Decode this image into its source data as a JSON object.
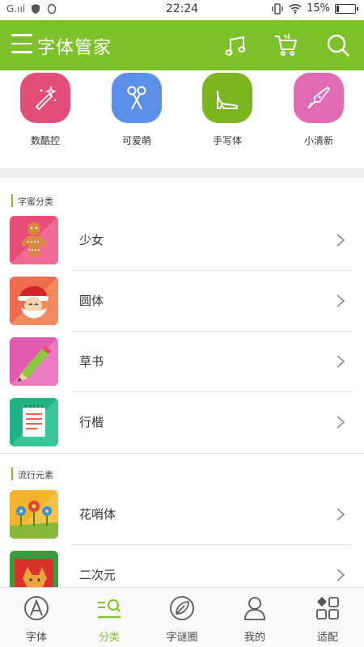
{
  "status_bar": {
    "carrier": "G.ııl",
    "time": "22:24",
    "battery_pct_text": "15%",
    "battery_level": 0.15
  },
  "app_bar": {
    "title": "字体管家",
    "icons": [
      "menu-icon",
      "music-note-icon",
      "cart-icon",
      "search-icon"
    ]
  },
  "featured": [
    {
      "label": "数酷控",
      "color": "#e24e79",
      "icon": "magic-wand-icon"
    },
    {
      "label": "可爱萌",
      "color": "#5a8ee8",
      "icon": "scissors-icon"
    },
    {
      "label": "手写体",
      "color": "#7bb520",
      "icon": "high-heel-icon"
    },
    {
      "label": "小清新",
      "color": "#e06ab4",
      "icon": "fountain-pen-icon"
    }
  ],
  "sections": [
    {
      "title": "字蜜分类",
      "items": [
        {
          "label": "少女",
          "icon": "gingerbread-icon"
        },
        {
          "label": "圆体",
          "icon": "santa-icon"
        },
        {
          "label": "草书",
          "icon": "pencil-icon"
        },
        {
          "label": "行楷",
          "icon": "notepad-icon"
        }
      ]
    },
    {
      "title": "流行元素",
      "items": [
        {
          "label": "花哨体",
          "icon": "flowers-icon"
        },
        {
          "label": "二次元",
          "icon": "fox-icon"
        }
      ]
    }
  ],
  "bottom_nav": [
    {
      "label": "字体",
      "icon": "letter-a-icon",
      "active": false
    },
    {
      "label": "分类",
      "icon": "category-icon",
      "active": true
    },
    {
      "label": "字谜圈",
      "icon": "leaf-circle-icon",
      "active": false
    },
    {
      "label": "我的",
      "icon": "user-icon",
      "active": false
    },
    {
      "label": "适配",
      "icon": "apps-icon",
      "active": false
    }
  ],
  "colors": {
    "accent": "#7dc22b",
    "divider": "#e3e3e3"
  }
}
